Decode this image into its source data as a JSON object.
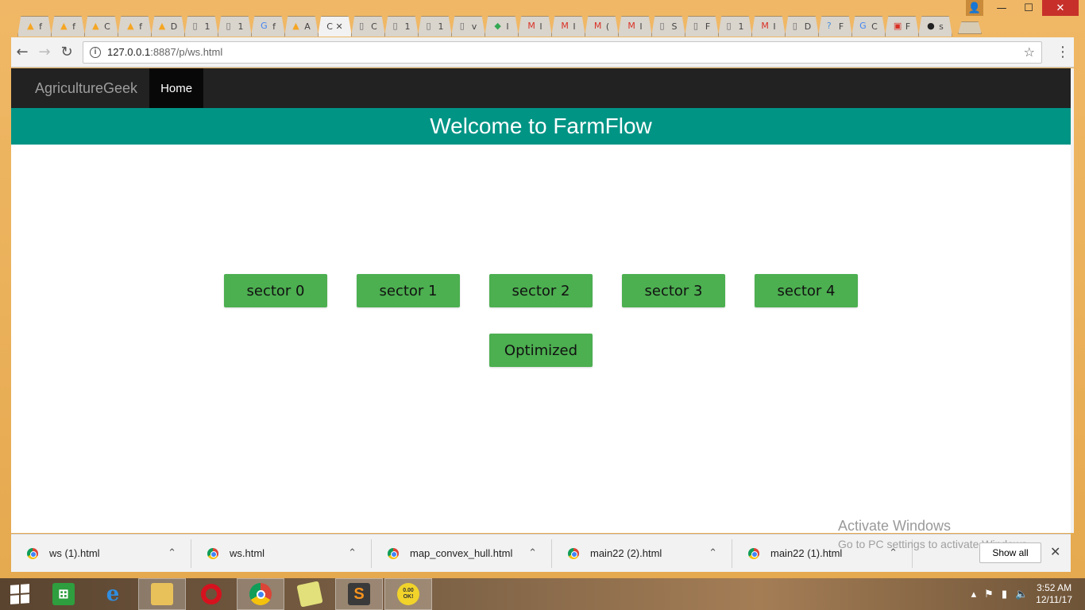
{
  "browser": {
    "tabs": [
      {
        "icon": "firebase-icon",
        "glyph": "▲",
        "color": "#f5a623",
        "label": "f"
      },
      {
        "icon": "firebase-icon",
        "glyph": "▲",
        "color": "#f5a623",
        "label": "f"
      },
      {
        "icon": "firebase-icon",
        "glyph": "▲",
        "color": "#f5a623",
        "label": "C"
      },
      {
        "icon": "firebase-icon",
        "glyph": "▲",
        "color": "#f5a623",
        "label": "f"
      },
      {
        "icon": "firebase-icon",
        "glyph": "▲",
        "color": "#f5a623",
        "label": "D"
      },
      {
        "icon": "page-icon",
        "glyph": "▯",
        "color": "#666666",
        "label": "1"
      },
      {
        "icon": "page-icon",
        "glyph": "▯",
        "color": "#666666",
        "label": "1"
      },
      {
        "icon": "google-icon",
        "glyph": "G",
        "color": "#4285f4",
        "label": "f"
      },
      {
        "icon": "firebase-icon",
        "glyph": "▲",
        "color": "#f5a623",
        "label": "A"
      },
      {
        "icon": "none",
        "glyph": "",
        "color": "#666666",
        "label": "C ✕",
        "active": true
      },
      {
        "icon": "page-icon",
        "glyph": "▯",
        "color": "#666666",
        "label": "C"
      },
      {
        "icon": "page-icon",
        "glyph": "▯",
        "color": "#666666",
        "label": "1"
      },
      {
        "icon": "page-icon",
        "glyph": "▯",
        "color": "#666666",
        "label": "1"
      },
      {
        "icon": "page-icon",
        "glyph": "▯",
        "color": "#666666",
        "label": "v"
      },
      {
        "icon": "maps-icon",
        "glyph": "◆",
        "color": "#34a853",
        "label": "I"
      },
      {
        "icon": "gmail-icon",
        "glyph": "M",
        "color": "#d93025",
        "label": "I"
      },
      {
        "icon": "gmail-icon",
        "glyph": "M",
        "color": "#d93025",
        "label": "I"
      },
      {
        "icon": "gmail-icon",
        "glyph": "M",
        "color": "#d93025",
        "label": "("
      },
      {
        "icon": "gmail-icon",
        "glyph": "M",
        "color": "#d93025",
        "label": "I"
      },
      {
        "icon": "page-icon",
        "glyph": "▯",
        "color": "#666666",
        "label": "S"
      },
      {
        "icon": "page-icon",
        "glyph": "▯",
        "color": "#666666",
        "label": "F"
      },
      {
        "icon": "page-icon",
        "glyph": "▯",
        "color": "#666666",
        "label": "1"
      },
      {
        "icon": "gmail-icon",
        "glyph": "M",
        "color": "#d93025",
        "label": "I"
      },
      {
        "icon": "page-icon",
        "glyph": "▯",
        "color": "#666666",
        "label": "D"
      },
      {
        "icon": "help-icon",
        "glyph": "?",
        "color": "#4a90d9",
        "label": "F"
      },
      {
        "icon": "google-icon",
        "glyph": "G",
        "color": "#4285f4",
        "label": "C"
      },
      {
        "icon": "apps-icon",
        "glyph": "▣",
        "color": "#d93025",
        "label": "F"
      },
      {
        "icon": "github-icon",
        "glyph": "●",
        "color": "#222222",
        "label": "s"
      }
    ],
    "url_host": "127.0.0.1",
    "url_rest": ":8887/p/ws.html"
  },
  "page": {
    "brand": "AgricultureGeek",
    "nav_home": "Home",
    "banner": "Welcome to FarmFlow",
    "sectors": [
      "sector 0",
      "sector 1",
      "sector 2",
      "sector 3",
      "sector 4"
    ],
    "optimized": "Optimized"
  },
  "watermark": {
    "title": "Activate Windows",
    "subtitle": "Go to PC settings to activate Windows."
  },
  "downloads": {
    "items": [
      "ws (1).html",
      "ws.html",
      "map_convex_hull.html",
      "main22 (2).html",
      "main22 (1).html"
    ],
    "show_all": "Show all"
  },
  "taskbar": {
    "time": "3:52 AM",
    "date": "12/11/17",
    "speed_badge": "0.00 OK!"
  },
  "colors": {
    "banner": "#009485",
    "button": "#4caf50",
    "navbar": "#222222"
  }
}
